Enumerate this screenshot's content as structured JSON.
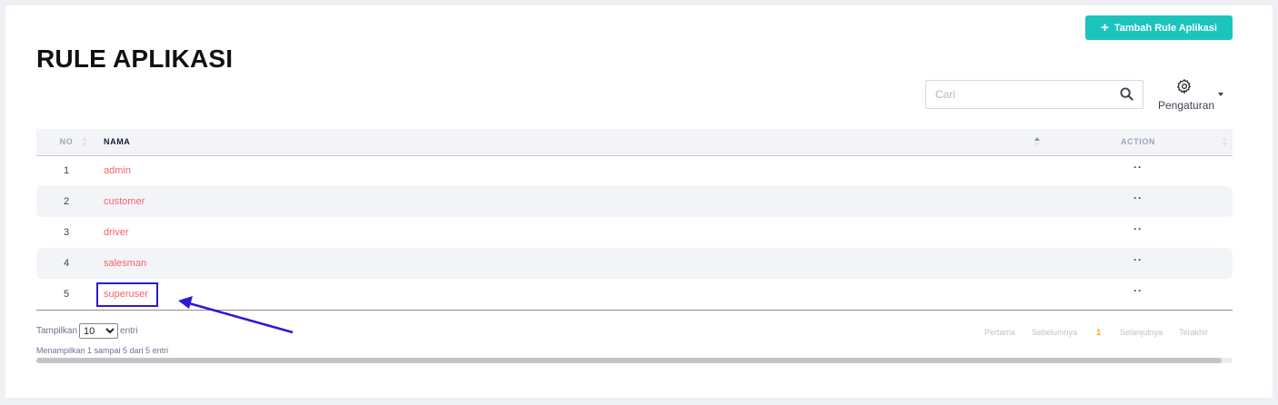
{
  "header": {
    "title": "RULE APLIKASI",
    "add_button": "Tambah Rule Aplikasi"
  },
  "toolbar": {
    "search_placeholder": "Cari",
    "settings_label": "Pengaturan"
  },
  "table": {
    "columns": {
      "no": "NO",
      "nama": "NAMA",
      "action": "ACTION"
    },
    "rows": [
      {
        "no": "1",
        "nama": "admin",
        "action": "··"
      },
      {
        "no": "2",
        "nama": "customer",
        "action": "··"
      },
      {
        "no": "3",
        "nama": "driver",
        "action": "··"
      },
      {
        "no": "4",
        "nama": "salesman",
        "action": "··"
      },
      {
        "no": "5",
        "nama": "superuser",
        "action": "··"
      }
    ]
  },
  "footer": {
    "length_prefix": "Tampilkan",
    "length_value": "10",
    "length_suffix": "entri",
    "info": "Menampilkan 1 sampai 5 dari 5 entri",
    "pager": {
      "first": "Pertama",
      "prev": "Sebelumnya",
      "current": "1",
      "next": "Selanjutnya",
      "last": "Terakhir"
    }
  },
  "colors": {
    "accent": "#1bc5bd",
    "link": "#f1646c",
    "annotation": "#2d18d6",
    "current_page": "#ffa800"
  }
}
